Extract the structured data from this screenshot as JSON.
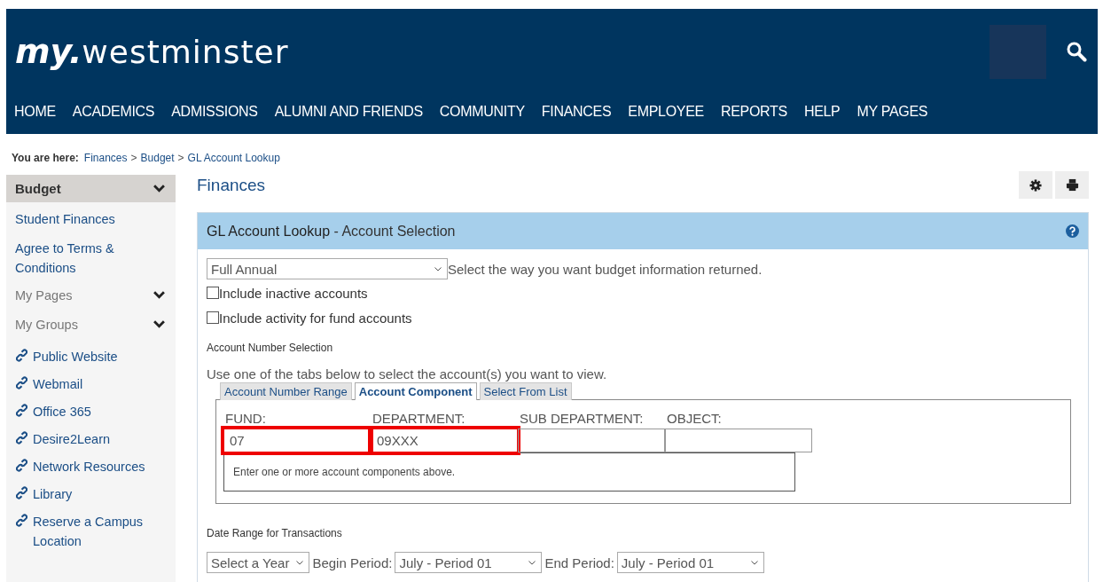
{
  "header": {
    "logo": {
      "prefix": "my.",
      "name": "westminster"
    },
    "nav": [
      "HOME",
      "ACADEMICS",
      "ADMISSIONS",
      "ALUMNI AND FRIENDS",
      "COMMUNITY",
      "FINANCES",
      "EMPLOYEE",
      "REPORTS",
      "HELP",
      "MY PAGES"
    ]
  },
  "breadcrumb": {
    "label": "You are here:",
    "items": [
      "Finances",
      "Budget",
      "GL Account Lookup"
    ],
    "separator": ">"
  },
  "sidebar": {
    "title": "Budget",
    "items": [
      {
        "kind": "link",
        "label": "Student Finances"
      },
      {
        "kind": "link",
        "label": "Agree to Terms & Conditions"
      },
      {
        "kind": "group",
        "label": "My Pages",
        "expanded": false
      },
      {
        "kind": "group",
        "label": "My Groups",
        "expanded": false
      },
      {
        "kind": "external",
        "label": "Public Website"
      },
      {
        "kind": "external",
        "label": "Webmail"
      },
      {
        "kind": "external",
        "label": "Office 365"
      },
      {
        "kind": "external",
        "label": "Desire2Learn"
      },
      {
        "kind": "external",
        "label": "Network Resources"
      },
      {
        "kind": "external",
        "label": "Library"
      },
      {
        "kind": "external",
        "label": "Reserve a Campus Location"
      }
    ]
  },
  "page_title": "Finances",
  "panel": {
    "title": "GL Account Lookup",
    "subtitle": "- Account Selection",
    "format_select": {
      "value": "Full Annual",
      "hint": "Select the way you want budget information returned."
    },
    "options": [
      {
        "label": "Include inactive accounts",
        "checked": false
      },
      {
        "label": "Include activity for fund accounts",
        "checked": false
      }
    ],
    "account_section": {
      "heading": "Account Number Selection",
      "instructions": "Use one of the tabs below to select the account(s) you want to view.",
      "tabs": [
        {
          "label": "Account Number Range",
          "selected": false
        },
        {
          "label": "Account Component",
          "selected": true
        },
        {
          "label": "Select From List",
          "selected": false
        }
      ],
      "fields": [
        {
          "label": "FUND:",
          "value": "07",
          "highlighted": true
        },
        {
          "label": "DEPARTMENT:",
          "value": "09XXX",
          "highlighted": true
        },
        {
          "label": "SUB DEPARTMENT:",
          "highlighted": false
        },
        {
          "label": "OBJECT:",
          "highlighted": false
        }
      ],
      "message": "Enter one or more account components above."
    },
    "date_section": {
      "heading": "Date Range for Transactions",
      "year_select": "Select a Year",
      "begin_label": "Begin Period:",
      "begin_select": "July - Period 01",
      "end_label": "End Period:",
      "end_select": "July - Period 01"
    }
  }
}
